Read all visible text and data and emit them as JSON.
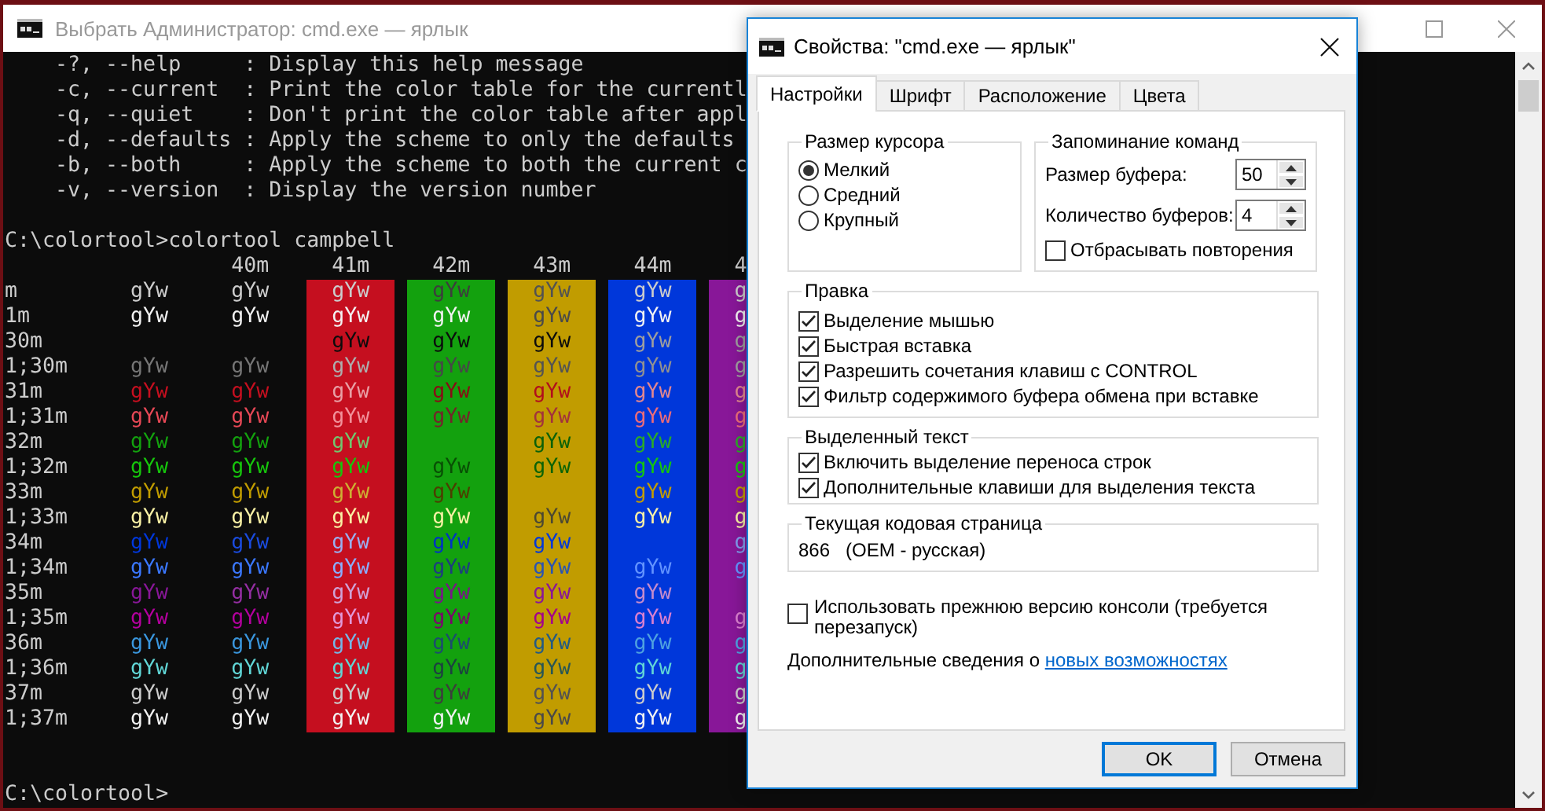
{
  "console_window": {
    "title": "Выбрать Администратор: cmd.exe — ярлык",
    "help_lines": [
      "    -?, --help     : Display this help message",
      "    -c, --current  : Print the color table for the currentl",
      "    -q, --quiet    : Don't print the color table after appl",
      "    -d, --defaults : Apply the scheme to only the defaults",
      "    -b, --both     : Apply the scheme to both the current c",
      "    -v, --version  : Display the version number"
    ],
    "command": "C:\\colortool>colortool campbell",
    "table": {
      "columns": [
        {
          "header": "40m",
          "color": "#0c0c0c"
        },
        {
          "header": "41m",
          "color": "#c50f1f"
        },
        {
          "header": "42m",
          "color": "#13a10e"
        },
        {
          "header": "43m",
          "color": "#c19c00"
        },
        {
          "header": "44m",
          "color": "#0037da"
        },
        {
          "header": "4",
          "color": "#881798"
        }
      ],
      "rows": [
        {
          "label": "m",
          "color": "#cccccc",
          "plain": "gYw",
          "cells": [
            "gYw",
            "gYw",
            "gYw",
            "gYw",
            "gYw",
            "g"
          ]
        },
        {
          "label": "1m",
          "color": "#f2f2f2",
          "plain": "gYw",
          "cells": [
            "gYw",
            "gYw",
            "gYw",
            "gYw",
            "gYw",
            "g"
          ]
        },
        {
          "label": "30m",
          "color": "#0c0c0c",
          "cells": [
            null,
            "gYw",
            "gYw",
            "gYw",
            "gYw",
            "g"
          ]
        },
        {
          "label": "1;30m",
          "color": "#767676",
          "plain": "gYw",
          "cells": [
            "gYw",
            "gYw",
            "gYw",
            "gYw",
            "gYw",
            "g"
          ]
        },
        {
          "label": "31m",
          "color": "#c50f1f",
          "plain": "gYw",
          "cells": [
            "gYw",
            "gYw",
            "gYw",
            "gYw",
            "gYw",
            "g"
          ]
        },
        {
          "label": "1;31m",
          "color": "#e74856",
          "plain": "gYw",
          "cells": [
            "gYw",
            "gYw",
            "gYw",
            "gYw",
            "gYw",
            "g"
          ]
        },
        {
          "label": "32m",
          "color": "#13a10e",
          "plain": "gYw",
          "cells": [
            "gYw",
            "gYw",
            null,
            "gYw",
            "gYw",
            "g"
          ]
        },
        {
          "label": "1;32m",
          "color": "#16c60c",
          "plain": "gYw",
          "cells": [
            "gYw",
            "gYw",
            "gYw",
            "gYw",
            "gYw",
            "g"
          ]
        },
        {
          "label": "33m",
          "color": "#c19c00",
          "plain": "gYw",
          "cells": [
            "gYw",
            "gYw",
            "gYw",
            null,
            "gYw",
            "g"
          ]
        },
        {
          "label": "1;33m",
          "color": "#f9f1a5",
          "plain": "gYw",
          "cells": [
            "gYw",
            "gYw",
            "gYw",
            "gYw",
            "gYw",
            "g"
          ]
        },
        {
          "label": "34m",
          "color": "#0037da",
          "plain": "gYw",
          "cells": [
            "gYw",
            "gYw",
            "gYw",
            "gYw",
            null,
            "g"
          ]
        },
        {
          "label": "1;34m",
          "color": "#3b78ff",
          "plain": "gYw",
          "cells": [
            "gYw",
            "gYw",
            "gYw",
            "gYw",
            "gYw",
            "g"
          ]
        },
        {
          "label": "35m",
          "color": "#881798",
          "plain": "gYw",
          "cells": [
            "gYw",
            "gYw",
            "gYw",
            "gYw",
            "gYw",
            null
          ]
        },
        {
          "label": "1;35m",
          "color": "#b4009e",
          "plain": "gYw",
          "cells": [
            "gYw",
            "gYw",
            "gYw",
            "gYw",
            "gYw",
            "g"
          ]
        },
        {
          "label": "36m",
          "color": "#3a96dd",
          "plain": "gYw",
          "cells": [
            "gYw",
            "gYw",
            "gYw",
            "gYw",
            "gYw",
            "g"
          ]
        },
        {
          "label": "1;36m",
          "color": "#61d6d6",
          "plain": "gYw",
          "cells": [
            "gYw",
            "gYw",
            "gYw",
            "gYw",
            "gYw",
            "g"
          ]
        },
        {
          "label": "37m",
          "color": "#cccccc",
          "plain": "gYw",
          "cells": [
            "gYw",
            "gYw",
            "gYw",
            "gYw",
            "gYw",
            "g"
          ]
        },
        {
          "label": "1;37m",
          "color": "#f2f2f2",
          "plain": "gYw",
          "cells": [
            "gYw",
            "gYw",
            "gYw",
            "gYw",
            "gYw",
            "g"
          ]
        }
      ]
    },
    "prompt": "C:\\colortool>"
  },
  "properties_dialog": {
    "title": "Свойства: \"cmd.exe — ярлык\"",
    "tabs": [
      {
        "label": "Настройки",
        "selected": true
      },
      {
        "label": "Шрифт",
        "selected": false
      },
      {
        "label": "Расположение",
        "selected": false
      },
      {
        "label": "Цвета",
        "selected": false
      }
    ],
    "cursor_size": {
      "title": "Размер курсора",
      "options": [
        {
          "label": "Мелкий",
          "selected": true
        },
        {
          "label": "Средний",
          "selected": false
        },
        {
          "label": "Крупный",
          "selected": false
        }
      ]
    },
    "command_history": {
      "title": "Запоминание команд",
      "fields": [
        {
          "label": "Размер буфера:",
          "value": "50"
        },
        {
          "label": "Количество буферов:",
          "value": "4"
        }
      ],
      "discard_duplicates": {
        "label": "Отбрасывать повторения",
        "checked": false
      }
    },
    "edit_options": {
      "title": "Правка",
      "items": [
        {
          "label": "Выделение мышью",
          "checked": true
        },
        {
          "label": "Быстрая вставка",
          "checked": true
        },
        {
          "label": "Разрешить сочетания клавиш с CONTROL",
          "checked": true
        },
        {
          "label": "Фильтр содержимого буфера обмена при вставке",
          "checked": true
        }
      ]
    },
    "text_selection": {
      "title": "Выделенный текст",
      "items": [
        {
          "label": "Включить выделение переноса строк",
          "checked": true
        },
        {
          "label": "Дополнительные клавиши для выделения текста",
          "checked": true
        }
      ]
    },
    "code_page": {
      "title": "Текущая кодовая страница",
      "number": "866",
      "name": "(OEM - русская)"
    },
    "legacy_console": {
      "label": "Использовать прежнюю версию консоли (требуется перезапуск)",
      "checked": false
    },
    "more_info": {
      "text": "Дополнительные сведения о",
      "link": "новых возможностях"
    },
    "buttons": [
      {
        "label": "OK",
        "focused": true
      },
      {
        "label": "Отмена",
        "focused": false
      }
    ]
  }
}
